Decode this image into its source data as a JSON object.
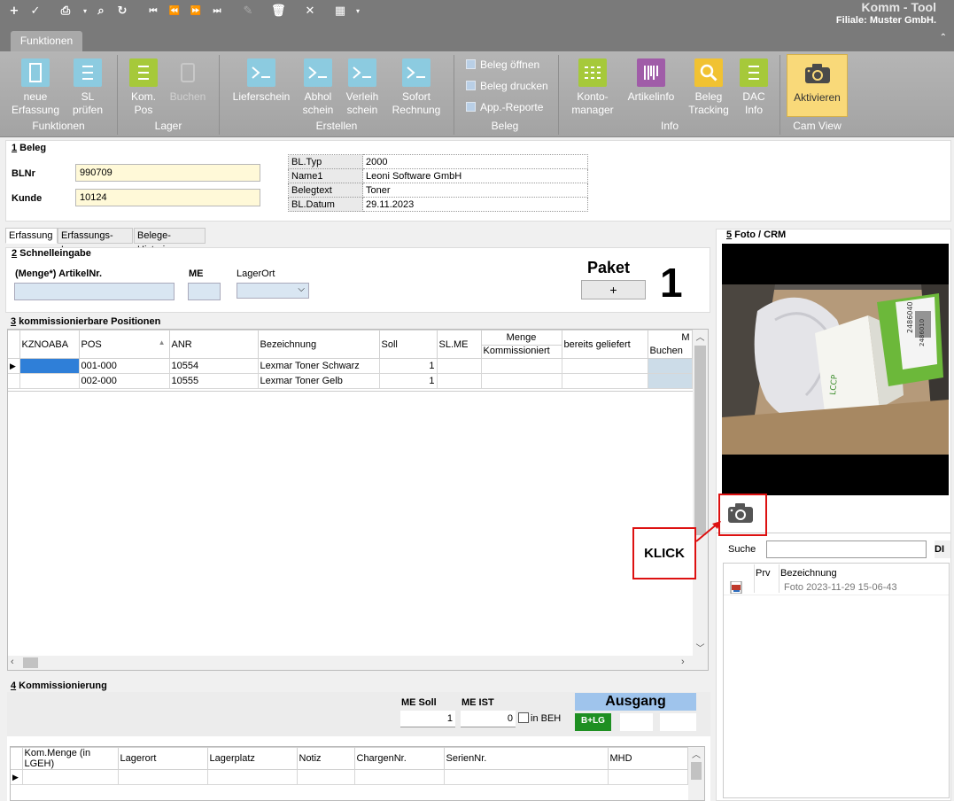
{
  "app": {
    "title": "Komm - Tool",
    "subtitle": "Filiale: Muster GmbH."
  },
  "ribbon": {
    "tab": "Funktionen",
    "groups": {
      "funktionen": "Funktionen",
      "lager": "Lager",
      "erstellen": "Erstellen",
      "beleg": "Beleg",
      "info": "Info",
      "camview": "Cam View"
    },
    "buttons": {
      "neue_erfassung": [
        "neue",
        "Erfassung"
      ],
      "sl_pruefen": [
        "SL",
        "prüfen"
      ],
      "kom_pos": [
        "Kom.",
        "Pos"
      ],
      "buchen": "Buchen",
      "lieferschein": "Lieferschein",
      "abholschein": [
        "Abhol",
        "schein"
      ],
      "verleihschein": [
        "Verleih",
        "schein"
      ],
      "sofortrechnung": [
        "Sofort",
        "Rechnung"
      ],
      "beleg_oeffnen": "Beleg öffnen",
      "beleg_drucken": "Beleg drucken",
      "app_reporte": "App.-Reporte",
      "kontomanager": [
        "Konto-",
        "manager"
      ],
      "artikelinfo": "Artikelinfo",
      "beleg_tracking": [
        "Beleg",
        "Tracking"
      ],
      "dac_info": [
        "DAC",
        "Info"
      ],
      "aktivieren": "Aktivieren"
    }
  },
  "beleg": {
    "heading_num": "1",
    "heading": " Beleg",
    "blnr_label": "BLNr",
    "blnr": "990709",
    "kunde_label": "Kunde",
    "kunde": "10124",
    "info": [
      {
        "k": "BL.Typ",
        "v": "2000"
      },
      {
        "k": "Name1",
        "v": "Leoni Software GmbH"
      },
      {
        "k": "Belegtext",
        "v": "Toner"
      },
      {
        "k": "BL.Datum",
        "v": "29.11.2023"
      }
    ]
  },
  "tabs": [
    "Erfassung",
    "Erfassungs-Log",
    "Belege-Historie"
  ],
  "schnelleingabe": {
    "heading_num": "2",
    "heading": " Schnelleingabe",
    "menge_label": "(Menge*)  ArtikelNr.",
    "me_label": "ME",
    "lagerort_label": "LagerOrt",
    "paket_label": "Paket",
    "paket_button": "+",
    "paket_count": "1"
  },
  "positionen": {
    "heading_num": "3",
    "heading": " kommissionierbare Positionen",
    "columns": [
      "KZNOABA",
      "POS",
      "ANR",
      "Bezeichnung",
      "Soll",
      "SL.ME",
      "Menge Kommissioniert",
      "bereits geliefert",
      "M Buchen"
    ],
    "col_menge_top": "Menge",
    "col_menge_bottom": "Kommissioniert",
    "col_m_top": "M",
    "col_m_bottom": "Buchen",
    "rows": [
      {
        "kz": "",
        "pos": "001-000",
        "anr": "10554",
        "bez": "Lexmar Toner Schwarz",
        "soll": "1"
      },
      {
        "kz": "",
        "pos": "002-000",
        "anr": "10555",
        "bez": "Lexmar Toner Gelb",
        "soll": "1"
      }
    ]
  },
  "kommissionierung": {
    "heading_num": "4",
    "heading": " Kommissionierung",
    "me_soll_label": "ME Soll",
    "me_soll": "1",
    "me_ist_label": "ME IST",
    "me_ist": "0",
    "in_beh": "in BEH",
    "ausgang": "Ausgang",
    "blg": "B+LG",
    "columns": [
      "Kom.Menge (in LGEH)",
      "Lagerort",
      "Lagerplatz",
      "Notiz",
      "ChargenNr.",
      "SerienNr.",
      "MHD"
    ]
  },
  "foto": {
    "heading_num": "5",
    "heading": " Foto / CRM",
    "suche_label": "Suche",
    "suche_button": "DI",
    "list_cols": [
      "Prv",
      "Bezeichnung"
    ],
    "items": [
      {
        "name": "Foto 2023-11-29 15-06-43"
      }
    ],
    "callout": "KLICK",
    "box_text": [
      "LCCP",
      "2486040",
      "2486010"
    ]
  },
  "colors": {
    "accent_yellow": "#f9d979",
    "highlight_red": "#dd1111",
    "ausgang_blue": "#9fc4ec",
    "blg_green": "#1e8f22"
  }
}
